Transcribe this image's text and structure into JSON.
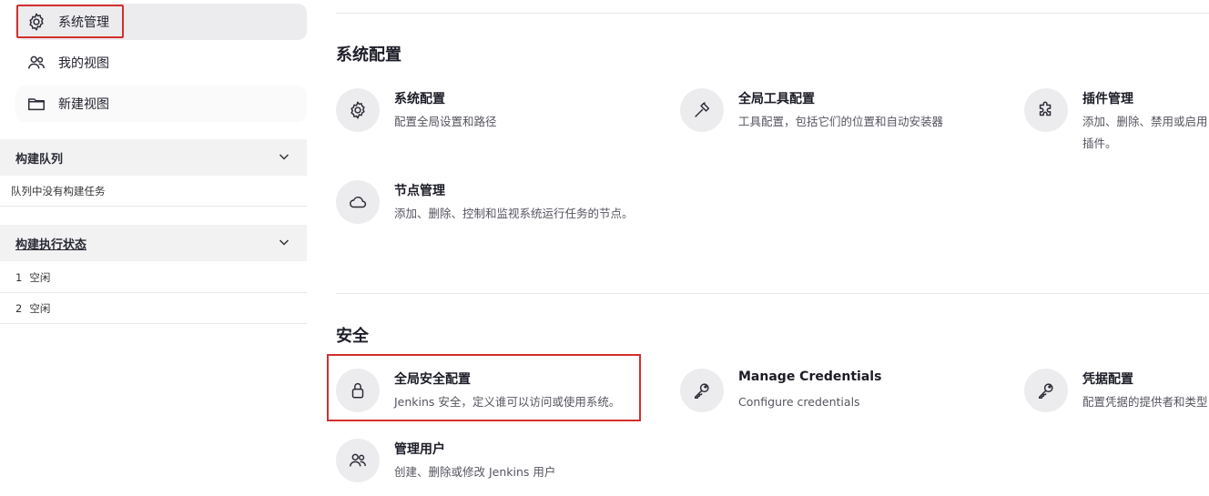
{
  "sidebar": {
    "nav": [
      {
        "label": "系统管理",
        "icon": "gear-icon"
      },
      {
        "label": "我的视图",
        "icon": "users-icon"
      },
      {
        "label": "新建视图",
        "icon": "folder-icon"
      }
    ],
    "build_queue": {
      "title": "构建队列",
      "empty": "队列中没有构建任务"
    },
    "executors": {
      "title": "构建执行状态",
      "rows": [
        {
          "num": "1",
          "status": "空闲"
        },
        {
          "num": "2",
          "status": "空闲"
        }
      ]
    }
  },
  "main": {
    "sections": [
      {
        "title": "系统配置",
        "cards": [
          {
            "title": "系统配置",
            "desc": "配置全局设置和路径",
            "icon": "gear-icon"
          },
          {
            "title": "全局工具配置",
            "desc": "工具配置，包括它们的位置和自动安装器",
            "icon": "hammer-icon"
          },
          {
            "title": "插件管理",
            "desc": "添加、删除、禁用或启用插件。",
            "icon": "puzzle-icon"
          },
          {
            "title": "节点管理",
            "desc": "添加、删除、控制和监视系统运行任务的节点。",
            "icon": "cloud-icon"
          }
        ]
      },
      {
        "title": "安全",
        "cards": [
          {
            "title": "全局安全配置",
            "desc": "Jenkins 安全，定义谁可以访问或使用系统。",
            "icon": "lock-icon"
          },
          {
            "title": "Manage Credentials",
            "desc": "Configure credentials",
            "icon": "key-icon"
          },
          {
            "title": "凭据配置",
            "desc": "配置凭据的提供者和类型",
            "icon": "key-icon"
          },
          {
            "title": "管理用户",
            "desc": "创建、删除或修改 Jenkins 用户",
            "icon": "users-icon"
          }
        ]
      }
    ]
  },
  "colors": {
    "highlight": "#d32f2f",
    "icon_bg": "#ececee",
    "panel_bg": "#f2f2f3"
  }
}
